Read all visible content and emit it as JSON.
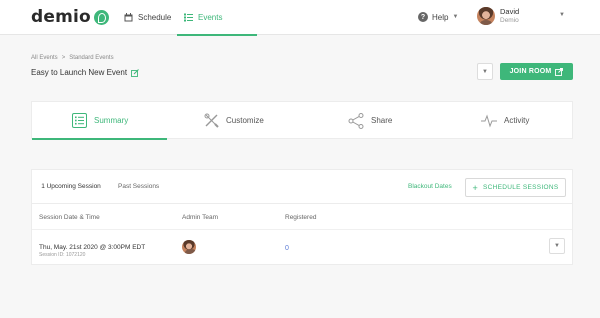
{
  "brand": {
    "logo_text": "demio",
    "accent": "#3eb77a"
  },
  "nav": {
    "schedule_label": "Schedule",
    "events_label": "Events",
    "help_label": "Help",
    "user_name": "David",
    "user_subtitle": "Demio"
  },
  "header": {
    "breadcrumb": [
      "All Events",
      "Standard Events"
    ],
    "breadcrumb_separator": ">",
    "title": "Easy to Launch New Event",
    "join_label": "JOIN ROOM"
  },
  "tabs": [
    {
      "label": "Summary",
      "icon": "list-icon",
      "active": true
    },
    {
      "label": "Customize",
      "icon": "wrench-pencil-icon",
      "active": false
    },
    {
      "label": "Share",
      "icon": "share-icon",
      "active": false
    },
    {
      "label": "Activity",
      "icon": "pulse-icon",
      "active": false
    }
  ],
  "sessions": {
    "tabs": [
      "1 Upcoming Session",
      "Past Sessions"
    ],
    "blackout_label": "Blackout Dates",
    "schedule_label": "SCHEDULE SESSIONS",
    "columns": [
      "Session Date & Time",
      "Admin Team",
      "Registered"
    ],
    "rows": [
      {
        "date": "Thu, May. 21st 2020 @ 3:00PM EDT",
        "session_id": "Session ID: 1072120",
        "registered": "0"
      }
    ]
  }
}
